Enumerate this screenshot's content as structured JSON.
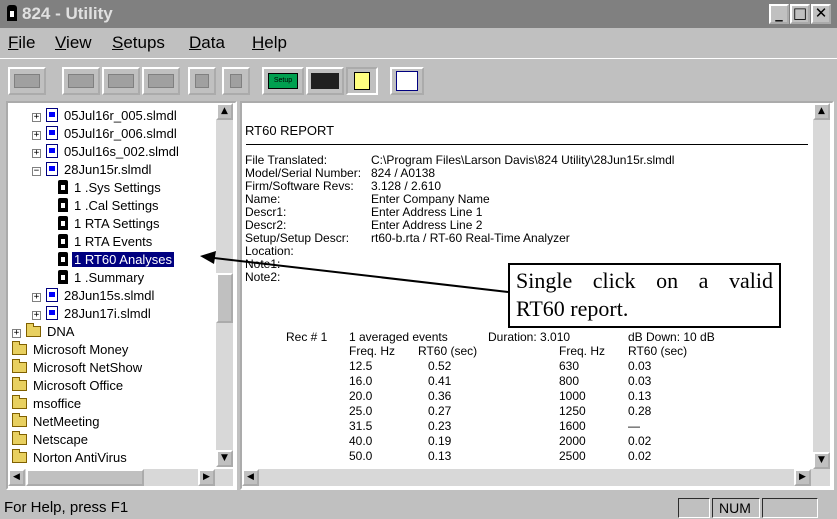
{
  "window": {
    "title": "824 - Utility",
    "controls": [
      "_",
      "□",
      "✕"
    ]
  },
  "menu": [
    "File",
    "View",
    "Setups",
    "Data",
    "Help"
  ],
  "toolbar": {
    "setup_label": "Setup"
  },
  "tree": {
    "items": [
      {
        "label": "05Jul16r_005.slmdl",
        "kind": "file",
        "expander": "+"
      },
      {
        "label": "05Jul16r_006.slmdl",
        "kind": "file",
        "expander": "+"
      },
      {
        "label": "05Jul16s_002.slmdl",
        "kind": "file",
        "expander": "+"
      },
      {
        "label": "28Jun15r.slmdl",
        "kind": "file",
        "expander": "−"
      },
      {
        "label": "1 .Sys Settings",
        "kind": "doc"
      },
      {
        "label": "1 .Cal Settings",
        "kind": "doc"
      },
      {
        "label": "1 RTA Settings",
        "kind": "doc"
      },
      {
        "label": "1 RTA Events",
        "kind": "doc"
      },
      {
        "label": "1 RT60 Analyses",
        "kind": "doc",
        "selected": true
      },
      {
        "label": "1 .Summary",
        "kind": "doc"
      },
      {
        "label": "28Jun15s.slmdl",
        "kind": "file",
        "expander": "+"
      },
      {
        "label": "28Jun17i.slmdl",
        "kind": "file",
        "expander": "+"
      },
      {
        "label": "DNA",
        "kind": "folder",
        "expander": "+"
      },
      {
        "label": "Microsoft Money",
        "kind": "folder"
      },
      {
        "label": "Microsoft NetShow",
        "kind": "folder"
      },
      {
        "label": "Microsoft Office",
        "kind": "folder"
      },
      {
        "label": "msoffice",
        "kind": "folder"
      },
      {
        "label": "NetMeeting",
        "kind": "folder"
      },
      {
        "label": "Netscape",
        "kind": "folder"
      },
      {
        "label": "Norton AntiVirus",
        "kind": "folder"
      }
    ]
  },
  "report": {
    "heading": "RT60 REPORT",
    "fields": [
      {
        "label": "File Translated:",
        "value": "C:\\Program Files\\Larson Davis\\824 Utility\\28Jun15r.slmdl"
      },
      {
        "label": "Model/Serial Number:",
        "value": "824 / A0138"
      },
      {
        "label": "Firm/Software Revs:",
        "value": "3.128 / 2.610"
      },
      {
        "label": "Name:",
        "value": "Enter Company Name"
      },
      {
        "label": "Descr1:",
        "value": "Enter Address Line 1"
      },
      {
        "label": "Descr2:",
        "value": "Enter Address Line 2"
      },
      {
        "label": "Setup/Setup Descr:",
        "value": "rt60-b.rta / RT-60 Real-Time Analyzer"
      },
      {
        "label": "Location:",
        "value": ""
      },
      {
        "label": "Note1:",
        "value": ""
      },
      {
        "label": "Note2:",
        "value": ""
      }
    ],
    "record": {
      "rec_label": "Rec # 1",
      "events": "1 averaged events",
      "duration": "Duration: 3.010",
      "db_down": "dB Down: 10 dB",
      "col_headers": [
        "Freq. Hz",
        "RT60 (sec)",
        "Freq. Hz",
        "RT60 (sec)"
      ],
      "rows": [
        [
          "12.5",
          "0.52",
          "630",
          "0.03"
        ],
        [
          "16.0",
          "0.41",
          "800",
          "0.03"
        ],
        [
          "20.0",
          "0.36",
          "1000",
          "0.13"
        ],
        [
          "25.0",
          "0.27",
          "1250",
          "0.28"
        ],
        [
          "31.5",
          "0.23",
          "1600",
          "—"
        ],
        [
          "40.0",
          "0.19",
          "2000",
          "0.02"
        ],
        [
          "50.0",
          "0.13",
          "2500",
          "0.02"
        ]
      ]
    }
  },
  "callout": {
    "line1_words": [
      "Single",
      "click",
      "on",
      "a",
      "valid"
    ],
    "line2": "RT60 report."
  },
  "status": {
    "help_text": "For Help, press F1",
    "num": "NUM"
  }
}
